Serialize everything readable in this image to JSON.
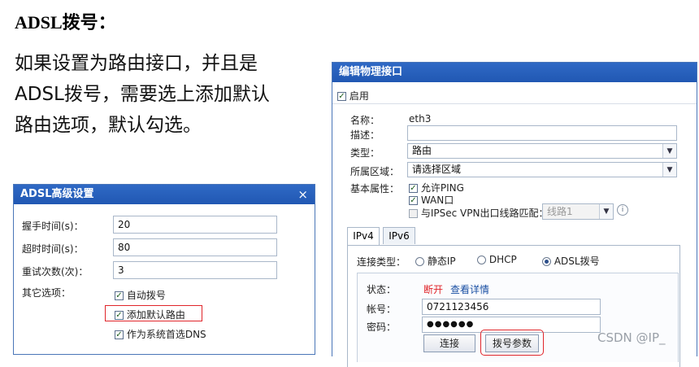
{
  "doc": {
    "title": "ADSL拨号：",
    "lines": [
      "如果设置为路由接口，并且是",
      "ADSL拨号，需要选上添加默认",
      "路由选项，默认勾选。"
    ]
  },
  "adsl_dialog": {
    "title": "ADSL高级设置",
    "close": "×",
    "handshake_label": "握手时间(s)：",
    "handshake_value": "20",
    "timeout_label": "超时时间(s)：",
    "timeout_value": "80",
    "retry_label": "重试次数(次)：",
    "retry_value": "3",
    "other_label": "其它选项：",
    "opt_auto_dial": "自动拨号",
    "opt_default_route": "添加默认路由",
    "opt_primary_dns": "作为系统首选DNS"
  },
  "edit_dialog": {
    "title": "编辑物理接口",
    "enable_label": "启用",
    "name_label": "名称：",
    "name_value": "eth3",
    "desc_label": "描述：",
    "desc_value": "",
    "type_label": "类型：",
    "type_value": "路由",
    "zone_label": "所属区域：",
    "zone_value": "请选择区域",
    "basic_label": "基本属性：",
    "allow_ping": "允许PING",
    "wan_port": "WAN口",
    "ipsec_match": "与IPSec VPN出口线路匹配：",
    "line_value": "线路1",
    "tab_ipv4": "IPv4",
    "tab_ipv6": "IPv6",
    "conn_type_label": "连接类型：",
    "radio_static": "静态IP",
    "radio_dhcp": "DHCP",
    "radio_adsl": "ADSL拨号",
    "status_label": "状态：",
    "status_value": "断开",
    "status_detail": "查看详情",
    "account_label": "帐号：",
    "account_value": "0721123456",
    "password_label": "密码：",
    "password_value": "●●●●●●",
    "connect_button": "连接",
    "dial_params_button": "拨号参数"
  },
  "watermark": "CSDN @IP_",
  "colors": {
    "title_bar": "#2158b3",
    "highlight_box": "#e0252a",
    "status_disconnected": "#e0252a",
    "link": "#1a4fa3"
  }
}
